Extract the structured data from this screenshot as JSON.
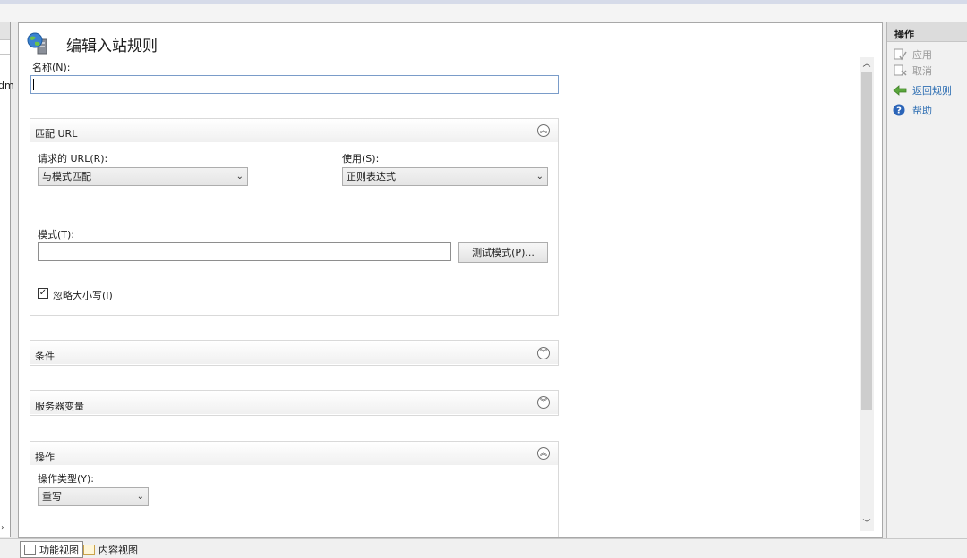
{
  "page": {
    "title": "编辑入站规则",
    "left_partial_text": "dm"
  },
  "name_field": {
    "label": "名称(N):",
    "value": ""
  },
  "match_url": {
    "title": "匹配 URL",
    "toggle_glyph": "︽",
    "requested_url_label": "请求的 URL(R):",
    "requested_url_value": "与模式匹配",
    "using_label": "使用(S):",
    "using_value": "正则表达式",
    "pattern_label": "模式(T):",
    "pattern_value": "",
    "test_button": "测试模式(P)...",
    "ignore_case_label": "忽略大小写(I)",
    "ignore_case_checked": true
  },
  "conditions": {
    "title": "条件",
    "toggle_glyph": "︾"
  },
  "server_variables": {
    "title": "服务器变量",
    "toggle_glyph": "︾"
  },
  "action": {
    "title": "操作",
    "toggle_glyph": "︽",
    "type_label": "操作类型(Y):",
    "type_value": "重写"
  },
  "actions_pane": {
    "header": "操作",
    "items": [
      {
        "label": "应用",
        "icon": "apply-icon",
        "enabled": false
      },
      {
        "label": "取消",
        "icon": "cancel-icon",
        "enabled": false
      },
      {
        "label": "返回规则",
        "icon": "back-arrow-icon",
        "enabled": true
      },
      {
        "label": "帮助",
        "icon": "help-icon",
        "enabled": true
      }
    ]
  },
  "bottom_tabs": [
    {
      "label": "功能视图",
      "active": true
    },
    {
      "label": "内容视图",
      "active": false
    }
  ],
  "colors": {
    "accent_link": "#2f6fb3",
    "back_arrow": "#5aa63c",
    "help": "#2b64b8"
  }
}
